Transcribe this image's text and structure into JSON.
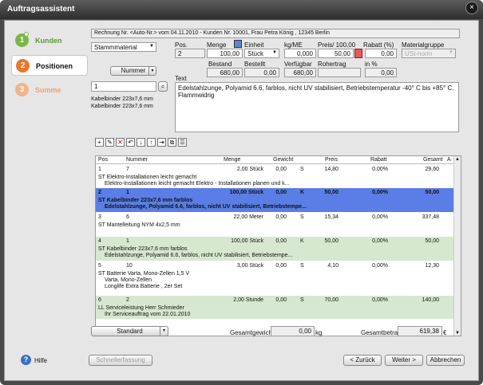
{
  "window": {
    "title": "Auftragsassistent",
    "close_icon": "×"
  },
  "nav": [
    {
      "num": "1",
      "label": "Kunden",
      "color": "#7ab648",
      "state": "done"
    },
    {
      "num": "2",
      "label": "Positionen",
      "color": "#e8772e",
      "state": "active"
    },
    {
      "num": "3",
      "label": "Summe",
      "color": "#f2b48a",
      "state": "pending"
    }
  ],
  "header_line": "Rechnung Nr. <Auto-Nr.> vom 04.11.2010 - Kunden Nr. 10001, Frau Petra König , 12345 Berlin",
  "stamm_select": "Stammmaterial",
  "num_select": "Nummer",
  "search_value": "1",
  "desc_lines": [
    "Kabelbinder 223x7,6 mm",
    "Kabelbinder 223x7,6 mm"
  ],
  "labels": {
    "pos": "Pos.",
    "menge": "Menge",
    "einheit": "Einheit",
    "kgme": "kg/ME",
    "preis": "Preis/ 100,00",
    "rabatt": "Rabatt (%)",
    "materialgruppe": "Materialgruppe",
    "bestand": "Bestand",
    "bestellt": "Bestellt",
    "verfuegbar": "Verfügbar",
    "rohertrag": "Rohertrag",
    "in_pct": "in %",
    "text": "Text"
  },
  "fields": {
    "pos": "2",
    "menge": "100,00",
    "einheit": "Stück",
    "kgme": "0,000",
    "preis": "50,00",
    "rabatt": "0,00",
    "materialgruppe": "USt-norm",
    "bestand": "680,00",
    "bestellt": "0,00",
    "verfuegbar": "680,00",
    "rohertrag": "",
    "in_pct": "0,00"
  },
  "text_field": "Edelstahlzunge, Polyamid 6.6, farblos, nicht UV stabilisiert, Betriebstemperatur -40° C bis +85° C. Flammwidrig",
  "grid": {
    "headers": [
      "Pos",
      "Nummer",
      "Menge",
      "Gewicht",
      "Preis",
      "Rabatt",
      "Gesamt",
      "A"
    ],
    "rows": [
      {
        "pos": "1",
        "num": "7",
        "menge": "2,00 Stück",
        "gew": "0,00",
        "s": "S",
        "preis": "14,80",
        "rab": "0,00%",
        "ges": "29,60",
        "l1": "ST Elektro-Installationen leicht gemacht",
        "l2": "Elektro-Installationen leicht gemacht Elektro - Installationen planen und k...",
        "l3": "",
        "bg": "#ffffff",
        "sel": false
      },
      {
        "pos": "2",
        "num": "1",
        "menge": "100,00 Stück",
        "gew": "0,00",
        "s": "K",
        "preis": "50,00",
        "rab": "0,00%",
        "ges": "50,00",
        "l1": "ST Kabelbinder 223x7,6 mm farblos",
        "l2": "Edelstahlzunge, Polyamid 6.6, farblos, nicht UV stabilisiert, Betriebstempe...",
        "l3": "",
        "bg": "#5a7ee6",
        "sel": true
      },
      {
        "pos": "3",
        "num": "6",
        "menge": "22,00 Meter",
        "gew": "0,00",
        "s": "S",
        "preis": "15,34",
        "rab": "0,00%",
        "ges": "337,48",
        "l1": "ST Mantelleitung NYM 4x2,5 mm",
        "l2": "",
        "l3": "",
        "bg": "#ffffff",
        "sel": false
      },
      {
        "pos": "4",
        "num": "1",
        "menge": "100,00 Stück",
        "gew": "0,00",
        "s": "K",
        "preis": "50,00",
        "rab": "0,00%",
        "ges": "50,00",
        "l1": "ST Kabelbinder 223x7,6 mm farblos",
        "l2": "Edelstahlzunge, Polyamid 6.6, farblos, nicht UV stabilisiert, Betriebstempe...",
        "l3": "",
        "bg": "#d6e8cf",
        "sel": false
      },
      {
        "pos": "5",
        "num": "10",
        "menge": "3,00 Stück",
        "gew": "0,00",
        "s": "S",
        "preis": "4,10",
        "rab": "0,00%",
        "ges": "12,30",
        "l1": "ST Batterie Varta, Mono-Zellen 1,5 V",
        "l2": "Varta, Mono-Zellen",
        "l3": "Longlife Extra Batterie , 2er Set",
        "bg": "#ffffff",
        "sel": false
      },
      {
        "pos": "6",
        "num": "2",
        "menge": "2,00 Stunde",
        "gew": "0,00",
        "s": "S",
        "preis": "70,00",
        "rab": "0,00%",
        "ges": "140,00",
        "l1": "LL Serviceleistung Herr Schmieder",
        "l2": "Ihr Serviceauftrag vom 22.01.2010",
        "l3": "",
        "bg": "#d6e8cf",
        "sel": false
      }
    ]
  },
  "footer": {
    "standard": "Standard",
    "gesamtgewicht_label": "Gesamtgewicht",
    "gesamtgewicht": "0,00",
    "kg": "kg",
    "gesamtbetrag_label": "Gesamtbetrag",
    "gesamtbetrag": "619,38",
    "euro": "€"
  },
  "buttons": {
    "hilfe": "Hilfe",
    "schnellerfassung": "Schnellerfassung",
    "zurueck": "< Zurück",
    "weiter": "Weiter >",
    "abbrechen": "Abbrechen"
  }
}
